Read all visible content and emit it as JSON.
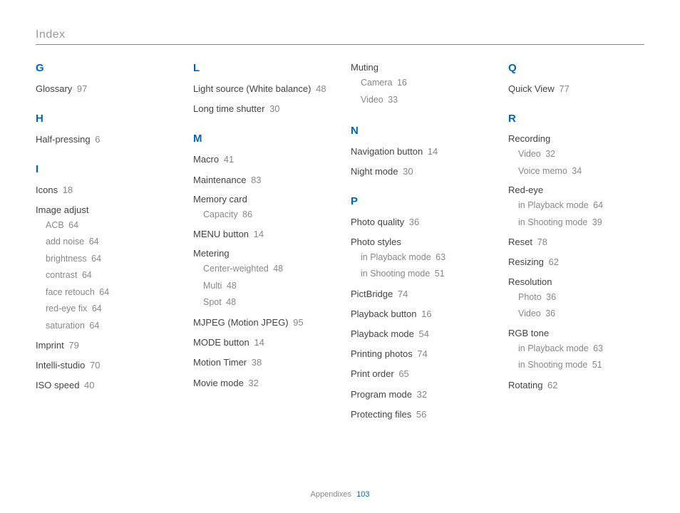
{
  "header": {
    "title": "Index"
  },
  "footer": {
    "section": "Appendixes",
    "page": "103"
  },
  "col1": {
    "sections": [
      {
        "letter": "G",
        "items": [
          {
            "label": "Glossary",
            "page": "97"
          }
        ]
      },
      {
        "letter": "H",
        "items": [
          {
            "label": "Half-pressing",
            "page": "6"
          }
        ]
      },
      {
        "letter": "I",
        "items": [
          {
            "label": "Icons",
            "page": "18"
          },
          {
            "label": "Image adjust",
            "subs": [
              {
                "label": "ACB",
                "page": "64"
              },
              {
                "label": "add noise",
                "page": "64"
              },
              {
                "label": "brightness",
                "page": "64"
              },
              {
                "label": "contrast",
                "page": "64"
              },
              {
                "label": "face retouch",
                "page": "64"
              },
              {
                "label": "red-eye fix",
                "page": "64"
              },
              {
                "label": "saturation",
                "page": "64"
              }
            ]
          },
          {
            "label": "Imprint",
            "page": "79"
          },
          {
            "label": "Intelli-studio",
            "page": "70"
          },
          {
            "label": "ISO speed",
            "page": "40"
          }
        ]
      }
    ]
  },
  "col2": {
    "sections": [
      {
        "letter": "L",
        "items": [
          {
            "label": "Light source (White balance)",
            "page": "48",
            "inline": true
          },
          {
            "label": "Long time shutter",
            "page": "30"
          }
        ]
      },
      {
        "letter": "M",
        "items": [
          {
            "label": "Macro",
            "page": "41"
          },
          {
            "label": "Maintenance",
            "page": "83"
          },
          {
            "label": "Memory card",
            "subs": [
              {
                "label": "Capacity",
                "page": "86"
              }
            ]
          },
          {
            "label": "MENU button",
            "page": "14"
          },
          {
            "label": "Metering",
            "subs": [
              {
                "label": "Center-weighted",
                "page": "48"
              },
              {
                "label": "Multi",
                "page": "48"
              },
              {
                "label": "Spot",
                "page": "48"
              }
            ]
          },
          {
            "label": "MJPEG (Motion JPEG)",
            "page": "95"
          },
          {
            "label": "MODE button",
            "page": "14"
          },
          {
            "label": "Motion Timer",
            "page": "38"
          },
          {
            "label": "Movie mode",
            "page": "32"
          }
        ]
      }
    ]
  },
  "col3": {
    "top": {
      "label": "Muting",
      "subs": [
        {
          "label": "Camera",
          "page": "16"
        },
        {
          "label": "Video",
          "page": "33"
        }
      ]
    },
    "sections": [
      {
        "letter": "N",
        "items": [
          {
            "label": "Navigation button",
            "page": "14"
          },
          {
            "label": "Night mode",
            "page": "30"
          }
        ]
      },
      {
        "letter": "P",
        "items": [
          {
            "label": "Photo quality",
            "page": "36"
          },
          {
            "label": "Photo styles",
            "subs": [
              {
                "label": "in Playback mode",
                "page": "63"
              },
              {
                "label": "in Shooting mode",
                "page": "51"
              }
            ]
          },
          {
            "label": "PictBridge",
            "page": "74"
          },
          {
            "label": "Playback button",
            "page": "16"
          },
          {
            "label": "Playback mode",
            "page": "54"
          },
          {
            "label": "Printing photos",
            "page": "74"
          },
          {
            "label": "Print order",
            "page": "65"
          },
          {
            "label": "Program mode",
            "page": "32"
          },
          {
            "label": "Protecting files",
            "page": "56"
          }
        ]
      }
    ]
  },
  "col4": {
    "sections": [
      {
        "letter": "Q",
        "items": [
          {
            "label": "Quick View",
            "page": "77"
          }
        ]
      },
      {
        "letter": "R",
        "items": [
          {
            "label": "Recording",
            "subs": [
              {
                "label": "Video",
                "page": "32"
              },
              {
                "label": "Voice memo",
                "page": "34"
              }
            ]
          },
          {
            "label": "Red-eye",
            "subs": [
              {
                "label": "in Playback mode",
                "page": "64"
              },
              {
                "label": "in Shooting mode",
                "page": "39"
              }
            ]
          },
          {
            "label": "Reset",
            "page": "78"
          },
          {
            "label": "Resizing",
            "page": "62"
          },
          {
            "label": "Resolution",
            "subs": [
              {
                "label": "Photo",
                "page": "36"
              },
              {
                "label": "Video",
                "page": "36"
              }
            ]
          },
          {
            "label": "RGB tone",
            "subs": [
              {
                "label": "in Playback mode",
                "page": "63"
              },
              {
                "label": "in Shooting mode",
                "page": "51"
              }
            ]
          },
          {
            "label": "Rotating",
            "page": "62"
          }
        ]
      }
    ]
  }
}
